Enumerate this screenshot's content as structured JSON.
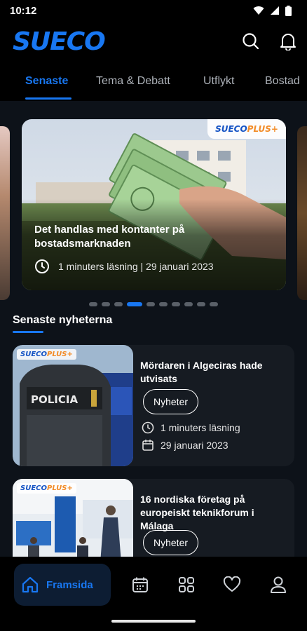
{
  "status_bar": {
    "time": "10:12"
  },
  "header": {
    "logo_text": "SUECO"
  },
  "tabs": [
    {
      "label": "Senaste",
      "active": true
    },
    {
      "label": "Tema & Debatt",
      "active": false
    },
    {
      "label": "Utflykt",
      "active": false
    },
    {
      "label": "Bostad",
      "active": false
    }
  ],
  "featured": {
    "badge_sueco": "SUECO",
    "badge_plus": "PLUS+",
    "title": "Det handlas med kontanter på bostadsmarknaden",
    "meta": "1 minuters läsning | 29 januari 2023",
    "dots_total": 10,
    "dots_active_index": 3
  },
  "section": {
    "title": "Senaste nyheterna"
  },
  "articles": [
    {
      "badge_sueco": "SUECO",
      "badge_plus": "PLUS+",
      "title": "Mördaren i Algeciras hade utvisats",
      "category": "Nyheter",
      "read_time": "1 minuters läsning",
      "date": "29 januari 2023",
      "image_text": "POLICIA"
    },
    {
      "badge_sueco": "SUECO",
      "badge_plus": "PLUS+",
      "title": "16 nordiska företag på europeiskt teknikforum i Málaga",
      "category": "Nyheter"
    }
  ],
  "bottom_nav": {
    "home_label": "Framsida",
    "items": [
      "home-icon",
      "calendar-icon",
      "grid-icon",
      "heart-icon",
      "profile-icon"
    ]
  },
  "colors": {
    "accent": "#1877f2",
    "background": "#0d1219",
    "card": "#161b22",
    "plus_orange": "#f28c28"
  }
}
